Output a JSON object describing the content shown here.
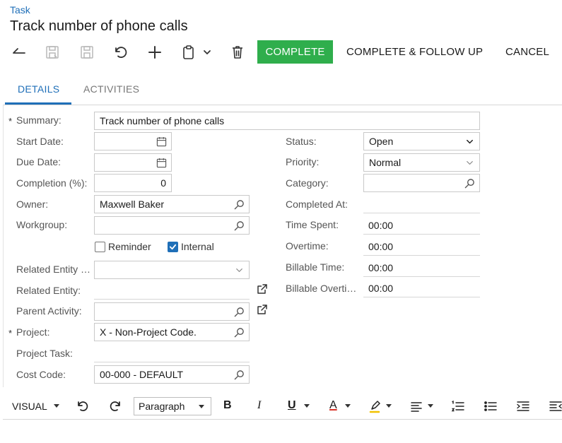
{
  "header": {
    "breadcrumb": "Task",
    "title": "Track number of phone calls"
  },
  "toolbar": {
    "complete_label": "COMPLETE",
    "complete_follow_label": "COMPLETE & FOLLOW UP",
    "cancel_label": "CANCEL",
    "accent_color": "#2fae4c"
  },
  "tabs": [
    {
      "label": "DETAILS",
      "active": true
    },
    {
      "label": "ACTIVITIES",
      "active": false
    }
  ],
  "form": {
    "required_mark": "*",
    "summary": {
      "label": "Summary:",
      "value": "Track number of phone calls"
    },
    "start_date": {
      "label": "Start Date:",
      "value": ""
    },
    "due_date": {
      "label": "Due Date:",
      "value": ""
    },
    "completion": {
      "label": "Completion (%):",
      "value": "0"
    },
    "owner": {
      "label": "Owner:",
      "value": "Maxwell Baker"
    },
    "workgroup": {
      "label": "Workgroup:",
      "value": ""
    },
    "reminder": {
      "label": "Reminder",
      "checked": false
    },
    "internal": {
      "label": "Internal",
      "checked": true
    },
    "related_entity_type": {
      "label": "Related Entity …",
      "value": ""
    },
    "related_entity": {
      "label": "Related Entity:",
      "value": ""
    },
    "parent_activity": {
      "label": "Parent Activity:",
      "value": ""
    },
    "project": {
      "label": "Project:",
      "value": "X - Non-Project Code."
    },
    "project_task": {
      "label": "Project Task:",
      "value": ""
    },
    "cost_code": {
      "label": "Cost Code:",
      "value": "00-000 - DEFAULT"
    },
    "status": {
      "label": "Status:",
      "value": "Open"
    },
    "priority": {
      "label": "Priority:",
      "value": "Normal"
    },
    "category": {
      "label": "Category:",
      "value": ""
    },
    "completed_at": {
      "label": "Completed At:",
      "value": ""
    },
    "time_spent": {
      "label": "Time Spent:",
      "value": "00:00"
    },
    "overtime": {
      "label": "Overtime:",
      "value": "00:00"
    },
    "billable_time": {
      "label": "Billable Time:",
      "value": "00:00"
    },
    "billable_overtime": {
      "label": "Billable Overti…",
      "value": "00:00"
    }
  },
  "editor": {
    "mode": "VISUAL",
    "paragraph": "Paragraph",
    "bold": "B",
    "italic": "I",
    "underline": "U",
    "font_color": "A",
    "font_color_hex": "#d93025",
    "highlight_hex": "#f2c200"
  }
}
